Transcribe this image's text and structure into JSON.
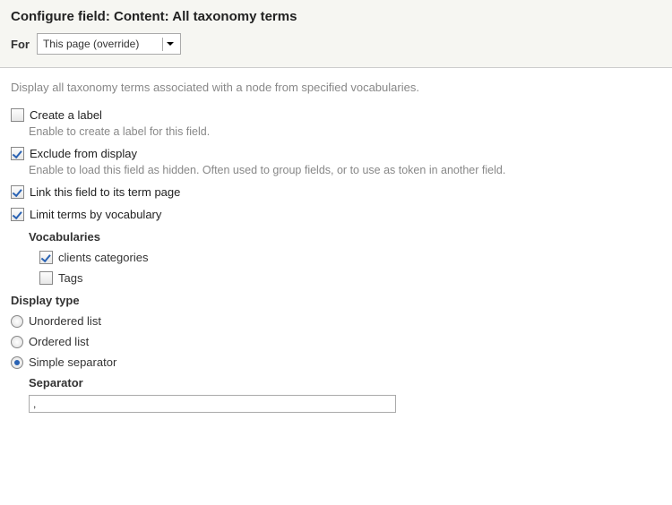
{
  "header": {
    "title": "Configure field: Content: All taxonomy terms",
    "for_label": "For",
    "for_value": "This page (override)"
  },
  "intro": "Display all taxonomy terms associated with a node from specified vocabularies.",
  "options": {
    "create_label": {
      "label": "Create a label",
      "desc": "Enable to create a label for this field.",
      "checked": false
    },
    "exclude": {
      "label": "Exclude from display",
      "desc": "Enable to load this field as hidden. Often used to group fields, or to use as token in another field.",
      "checked": true
    },
    "link_term": {
      "label": "Link this field to its term page",
      "checked": true
    },
    "limit_vocab": {
      "label": "Limit terms by vocabulary",
      "checked": true,
      "sub_label": "Vocabularies",
      "items": {
        "clients_categories": {
          "label": "clients  categories",
          "checked": true
        },
        "tags": {
          "label": "Tags",
          "checked": false
        }
      }
    }
  },
  "display_type": {
    "heading": "Display type",
    "options": {
      "unordered": "Unordered list",
      "ordered": "Ordered list",
      "simple": "Simple separator"
    },
    "selected": "simple",
    "separator": {
      "label": "Separator",
      "value": ","
    }
  }
}
